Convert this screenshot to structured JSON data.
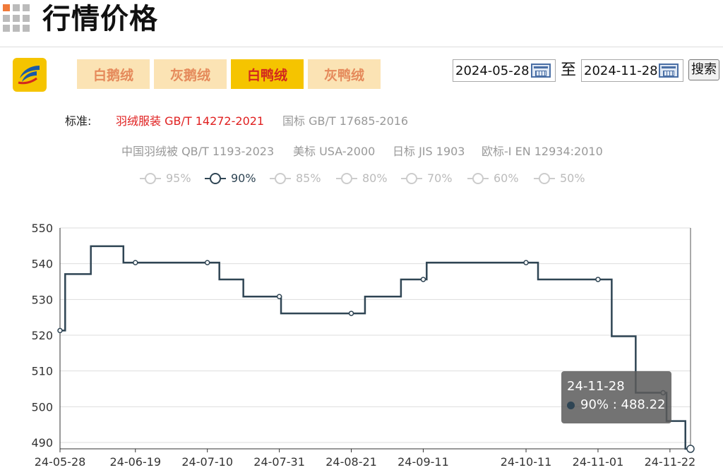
{
  "header": {
    "title": "行情价格"
  },
  "tabs": [
    {
      "label": "白鹅绒",
      "active": false
    },
    {
      "label": "灰鹅绒",
      "active": false
    },
    {
      "label": "白鸭绒",
      "active": true
    },
    {
      "label": "灰鸭绒",
      "active": false
    }
  ],
  "filters": {
    "start_date": "2024-05-28",
    "separator": "至",
    "end_date": "2024-11-28",
    "search_label": "搜索"
  },
  "standards": {
    "label": "标准:",
    "items": [
      {
        "label": "羽绒服装 GB/T 14272-2021",
        "active": true
      },
      {
        "label": "国标 GB/T 17685-2016",
        "active": false
      },
      {
        "label": "中国羽绒被 QB/T 1193-2023",
        "active": false
      },
      {
        "label": "美标 USA-2000",
        "active": false
      },
      {
        "label": "日标 JIS 1903",
        "active": false
      },
      {
        "label": "欧标-I EN 12934:2010",
        "active": false
      }
    ]
  },
  "legend": [
    {
      "label": "95%",
      "active": false
    },
    {
      "label": "90%",
      "active": true
    },
    {
      "label": "85%",
      "active": false
    },
    {
      "label": "80%",
      "active": false
    },
    {
      "label": "70%",
      "active": false
    },
    {
      "label": "60%",
      "active": false
    },
    {
      "label": "50%",
      "active": false
    }
  ],
  "colors": {
    "series": "#2f4554",
    "accent": "#f5c400",
    "inactive_tab": "#fbe3b4",
    "standard_active": "#e02020"
  },
  "tooltip": {
    "date": "24-11-28",
    "text": "90% : 488.22"
  },
  "chart_data": {
    "type": "line",
    "step": true,
    "ylim": [
      488.22,
      550
    ],
    "yticks": [
      490,
      500,
      510,
      520,
      530,
      540,
      550
    ],
    "x_tick_labels": [
      "24-05-28",
      "24-06-19",
      "24-07-10",
      "24-07-31",
      "24-08-21",
      "24-09-11",
      "24-10-11",
      "24-11-01",
      "24-11-22"
    ],
    "series": [
      {
        "name": "90%",
        "x": [
          "24-05-28",
          "24-05-31",
          "24-06-12",
          "24-06-19",
          "24-07-10",
          "24-07-17",
          "24-07-24",
          "24-07-31",
          "24-08-01",
          "24-08-21",
          "24-08-29",
          "24-09-11",
          "24-09-13",
          "24-10-11",
          "24-10-18",
          "24-11-01",
          "24-11-09",
          "24-11-15",
          "24-11-20",
          "24-11-22",
          "24-11-25",
          "24-11-28"
        ],
        "values": [
          521.3,
          537.1,
          544.9,
          540.3,
          540.3,
          535.6,
          530.8,
          530.8,
          526.1,
          526.1,
          530.8,
          535.6,
          540.3,
          540.3,
          535.6,
          535.6,
          519.7,
          503.9,
          503.9,
          496.0,
          496.0,
          488.22
        ]
      }
    ]
  }
}
